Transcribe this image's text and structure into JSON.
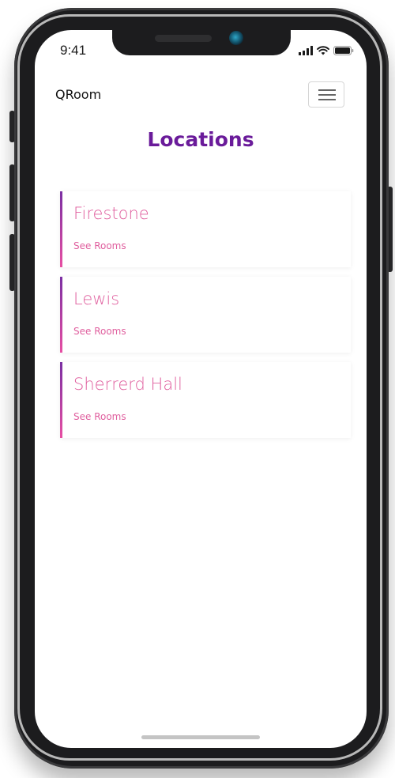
{
  "status_bar": {
    "time": "9:41"
  },
  "navbar": {
    "brand": "QRoom",
    "menu_icon": "hamburger-menu-icon"
  },
  "page": {
    "title": "Locations"
  },
  "locations": [
    {
      "name": "Firestone",
      "link_label": "See Rooms"
    },
    {
      "name": "Lewis",
      "link_label": "See Rooms"
    },
    {
      "name": "Sherrerd Hall",
      "link_label": "See Rooms"
    }
  ],
  "colors": {
    "title": "#6a1b9a",
    "accent": "#e0609f",
    "accent_gradient_start": "#7b2fa3",
    "accent_gradient_end": "#e74fa3"
  }
}
